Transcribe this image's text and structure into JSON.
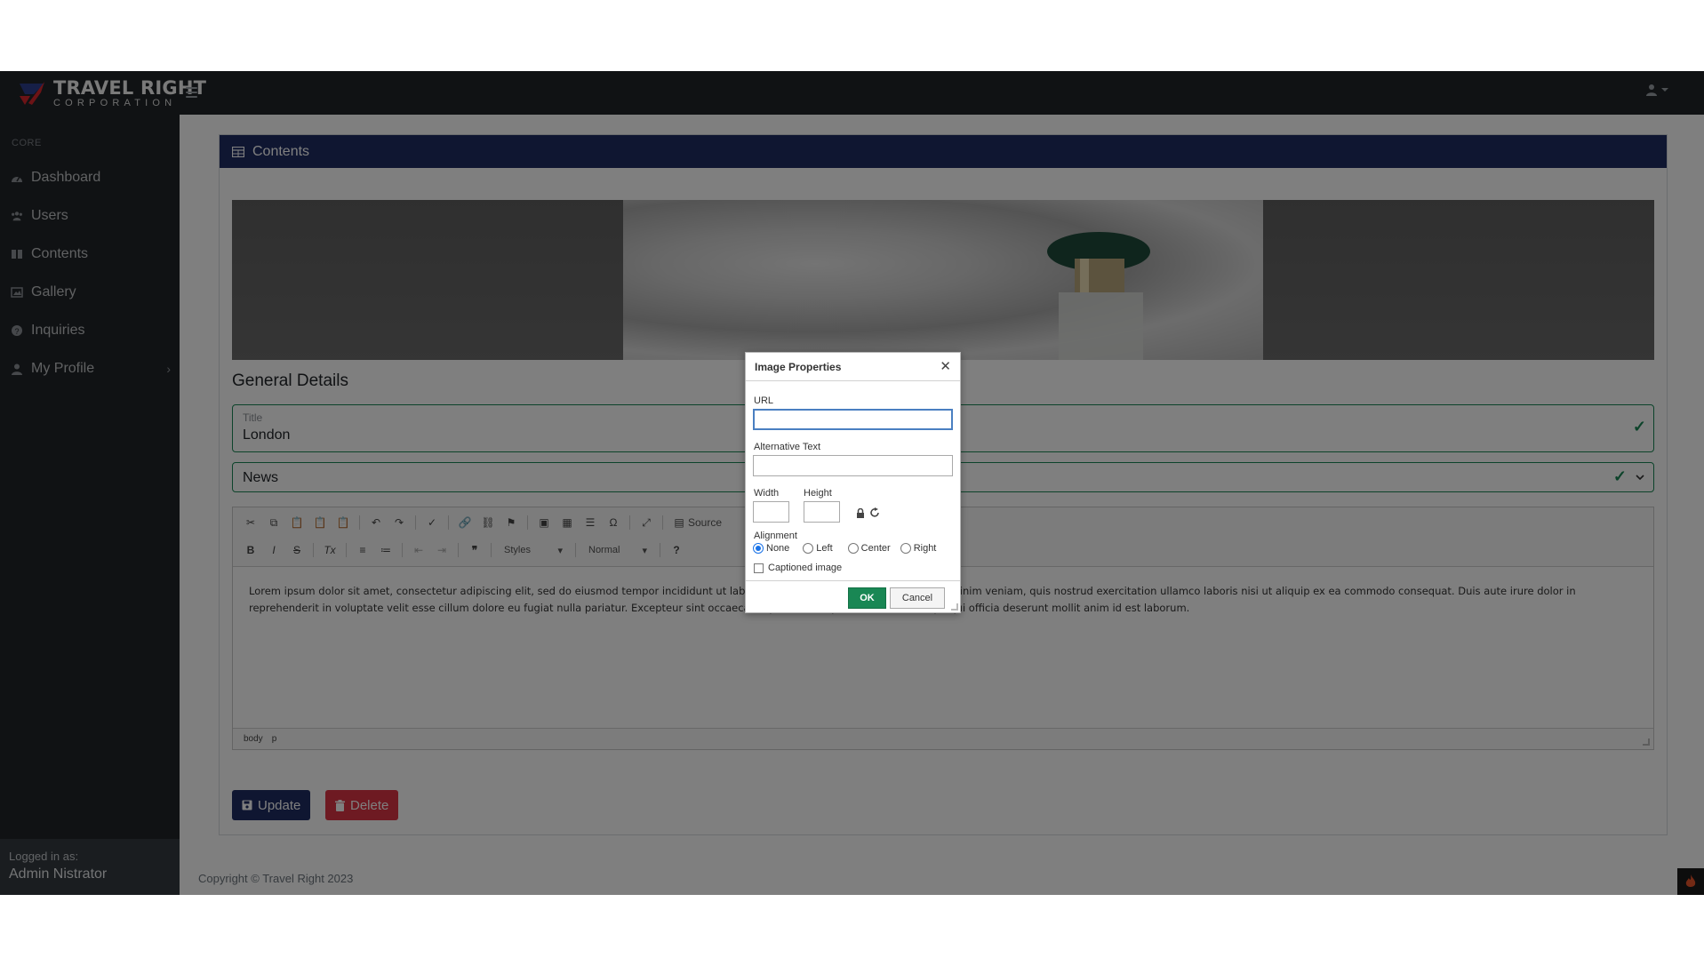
{
  "brand": {
    "title": "TRAVEL RIGHT",
    "subtitle": "CORPORATION"
  },
  "sidebar": {
    "heading": "CORE",
    "items": [
      {
        "label": "Dashboard",
        "icon": "dashboard-icon"
      },
      {
        "label": "Users",
        "icon": "users-icon"
      },
      {
        "label": "Contents",
        "icon": "book-icon"
      },
      {
        "label": "Gallery",
        "icon": "image-icon"
      },
      {
        "label": "Inquiries",
        "icon": "question-icon"
      },
      {
        "label": "My Profile",
        "icon": "user-icon"
      }
    ],
    "footer": {
      "label": "Logged in as:",
      "user": "Admin Nistrator"
    }
  },
  "card": {
    "title": "Contents"
  },
  "form": {
    "section_title": "General Details",
    "title_label": "Title",
    "title_value": "London",
    "category_value": "News"
  },
  "editor": {
    "toolbar": {
      "source_label": "Source",
      "styles_label": "Styles",
      "format_label": "Normal"
    },
    "body_text": "Lorem ipsum dolor sit amet, consectetur adipiscing elit, sed do eiusmod tempor incididunt ut labore et dolore magna aliqua. Ut enim ad minim veniam, quis nostrud exercitation ullamco laboris nisi ut aliquip ex ea commodo consequat. Duis aute irure dolor in reprehenderit in voluptate velit esse cillum dolore eu fugiat nulla pariatur. Excepteur sint occaecat cupidatat non proident, sunt in culpa qui officia deserunt mollit anim id est laborum.",
    "path": [
      "body",
      "p"
    ]
  },
  "buttons": {
    "update": "Update",
    "delete": "Delete"
  },
  "footer": {
    "copyright": "Copyright © Travel Right 2023"
  },
  "dialog": {
    "title": "Image Properties",
    "url_label": "URL",
    "url_value": "",
    "alt_label": "Alternative Text",
    "alt_value": "",
    "width_label": "Width",
    "height_label": "Height",
    "alignment_label": "Alignment",
    "alignment_options": [
      "None",
      "Left",
      "Center",
      "Right"
    ],
    "alignment_selected": "None",
    "captioned_label": "Captioned image",
    "ok_label": "OK",
    "cancel_label": "Cancel"
  },
  "colors": {
    "navbar": "#212529",
    "card_header": "#1e2d63",
    "valid_green": "#198754",
    "danger": "#dc3545"
  }
}
